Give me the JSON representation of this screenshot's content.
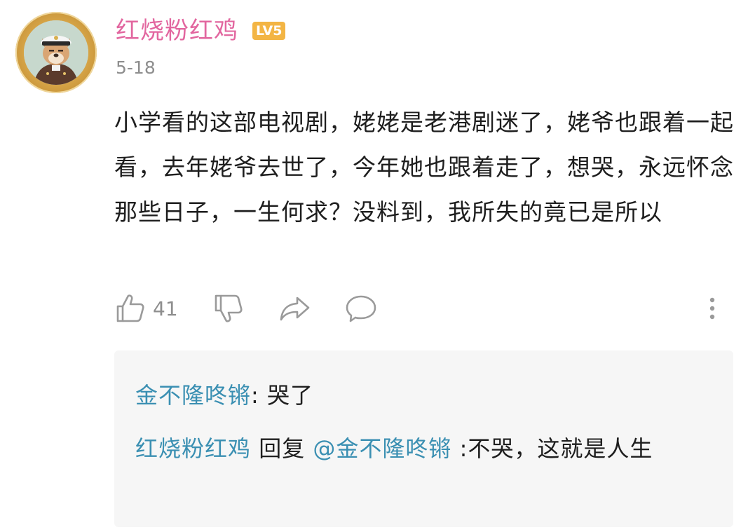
{
  "comment": {
    "author": "红烧粉红鸡",
    "level_badge": "LV5",
    "date": "5-18",
    "text": "小学看的这部电视剧，姥姥是老港剧迷了，姥爷也跟着一起看，去年姥爷去世了，今年她也跟着走了，想哭，永远怀念那些日子，一生何求？没料到，我所失的竟已是所以",
    "like_count": "41",
    "icons": {
      "like": "thumbs-up-icon",
      "dislike": "thumbs-down-icon",
      "share": "share-icon",
      "reply": "comment-bubble-icon",
      "more": "more-vertical-icon"
    }
  },
  "replies": [
    {
      "author": "金不隆咚锵",
      "separator": ": ",
      "text": "哭了"
    },
    {
      "author": "红烧粉红鸡",
      "reply_word": " 回复 ",
      "mention": "@金不隆咚锵",
      "text": " :不哭，这就是人生"
    }
  ],
  "colors": {
    "username": "#e2669f",
    "reply_name": "#3a8fb2",
    "badge": "#f3b544",
    "meta_gray": "#8e8e8e",
    "reply_bg": "#f6f6f6"
  }
}
